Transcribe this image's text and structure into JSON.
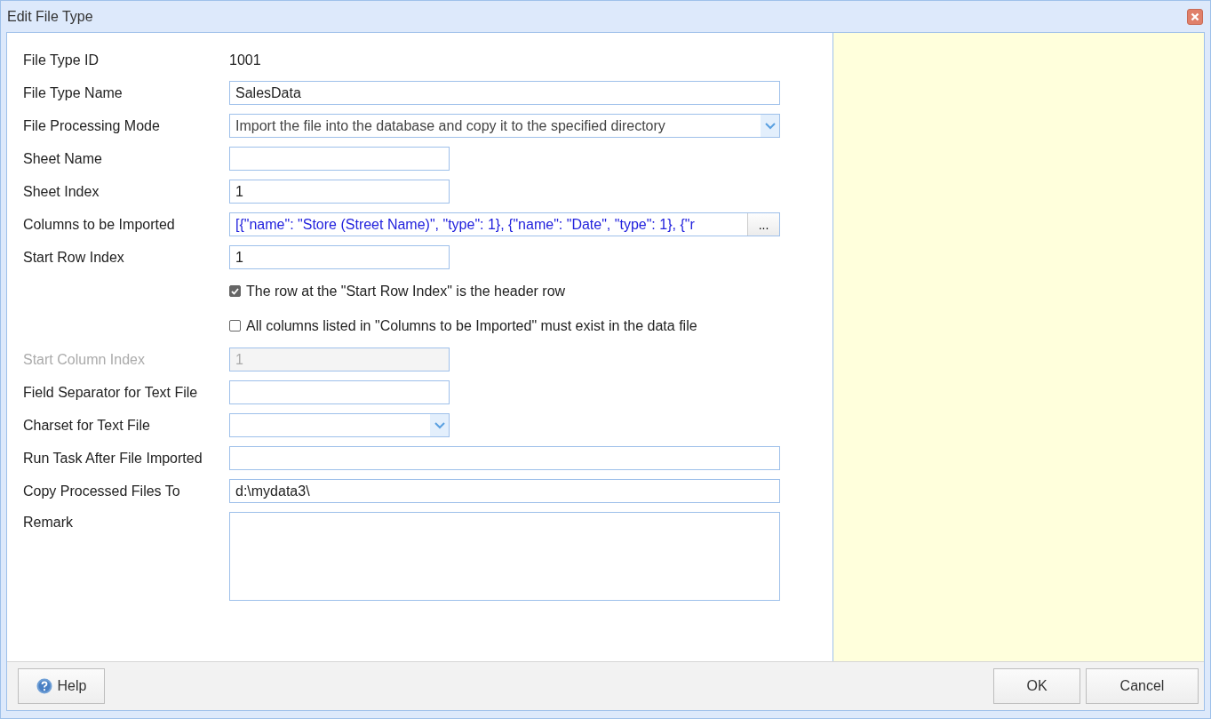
{
  "window": {
    "title": "Edit File Type"
  },
  "form": {
    "rows": [
      {
        "kind": "static",
        "label": "File Type ID",
        "value": "1001",
        "disabled": false
      },
      {
        "kind": "field",
        "label": "File Type Name",
        "value": "SalesData",
        "disabled": false
      },
      {
        "kind": "select",
        "label": "File Processing Mode",
        "value": "Import the file into the database and copy it to the specified directory",
        "disabled": false
      },
      {
        "kind": "shortfield",
        "label": "Sheet Name",
        "value": "",
        "disabled": false
      },
      {
        "kind": "shortfield",
        "label": "Sheet Index",
        "value": "1",
        "disabled": false
      },
      {
        "kind": "lookup",
        "label": "Columns to be Imported",
        "value": "[{\"name\": \"Store (Street Name)\", \"type\": 1}, {\"name\": \"Date\", \"type\": 1}, {\"r",
        "button": "...",
        "disabled": false
      },
      {
        "kind": "shortfield",
        "label": "Start Row Index",
        "value": "1",
        "disabled": false
      },
      {
        "kind": "checkbox",
        "label": "The row at the \"Start Row Index\" is the header row",
        "checked": true,
        "disabled": false
      },
      {
        "kind": "checkbox",
        "label": "All columns listed in \"Columns to be Imported\" must exist in the data file",
        "checked": false,
        "disabled": false
      },
      {
        "kind": "shortfield",
        "label": "Start Column Index",
        "value": "1",
        "disabled": true
      },
      {
        "kind": "shortfield",
        "label": "Field Separator for Text File",
        "value": "",
        "disabled": false
      },
      {
        "kind": "shortselect",
        "label": "Charset for Text File",
        "value": "",
        "disabled": false
      },
      {
        "kind": "field",
        "label": "Run Task After File Imported",
        "value": "",
        "disabled": false
      },
      {
        "kind": "field",
        "label": "Copy Processed Files To",
        "value": "d:\\mydata3\\",
        "disabled": false
      },
      {
        "kind": "textarea",
        "label": "Remark",
        "value": "",
        "disabled": false
      }
    ]
  },
  "footer": {
    "help_button": "Help",
    "ok_button": "OK",
    "cancel_button": "Cancel"
  }
}
